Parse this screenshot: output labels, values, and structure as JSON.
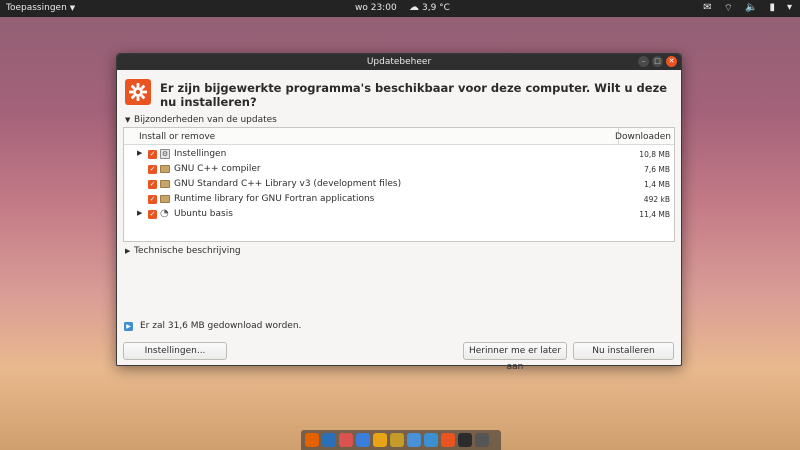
{
  "topbar": {
    "activities": "Toepassingen",
    "clock": "wo 23:00",
    "weather": "3,9 °C"
  },
  "dialog": {
    "title": "Updatebeheer",
    "heading": "Er zijn bijgewerkte programma's beschikbaar voor deze computer. Wilt u deze nu installeren?",
    "details_label": "Bijzonderheden van de updates",
    "tech_label": "Technische beschrijving",
    "columns": {
      "name": "Install or remove",
      "size": "Downloaden"
    },
    "rows": [
      {
        "name": "Instellingen",
        "size": "10,8 MB",
        "expandable": true,
        "icon": "settings-icon"
      },
      {
        "name": "GNU C++ compiler",
        "size": "7,6 MB",
        "expandable": false,
        "icon": "package-icon"
      },
      {
        "name": "GNU Standard C++ Library v3 (development files)",
        "size": "1,4 MB",
        "expandable": false,
        "icon": "package-icon"
      },
      {
        "name": "Runtime library for GNU Fortran applications",
        "size": "492 kB",
        "expandable": false,
        "icon": "package-icon"
      },
      {
        "name": "Ubuntu basis",
        "size": "11,4 MB",
        "expandable": true,
        "icon": "ubuntu-icon"
      }
    ],
    "status": "Er zal 31,6 MB gedownload worden.",
    "buttons": {
      "settings": "Instellingen...",
      "later": "Herinner me er later aan",
      "install": "Nu installeren"
    }
  },
  "colors": {
    "accent": "#e95420",
    "panel": "#232323",
    "titlebar": "#2f2f2f"
  },
  "dock": [
    {
      "name": "firefox-icon",
      "color": "#e66000"
    },
    {
      "name": "thunderbird-icon",
      "color": "#2a6fb7"
    },
    {
      "name": "software-icon",
      "color": "#d9534f"
    },
    {
      "name": "qbittorrent-icon",
      "color": "#3b7dd8"
    },
    {
      "name": "vlc-icon",
      "color": "#e8a317"
    },
    {
      "name": "system-monitor-icon",
      "color": "#c49a2a"
    },
    {
      "name": "files-icon",
      "color": "#4a90d9"
    },
    {
      "name": "update-icon",
      "color": "#3d8fd1"
    },
    {
      "name": "software-updater-icon",
      "color": "#e95420"
    },
    {
      "name": "terminal-icon",
      "color": "#2b2b2b"
    },
    {
      "name": "remote-desktop-icon",
      "color": "#555555"
    }
  ]
}
